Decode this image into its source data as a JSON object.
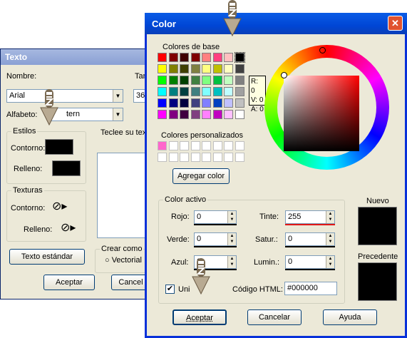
{
  "texto": {
    "title": "Texto",
    "nombre_label": "Nombre:",
    "tam_label": "Tan",
    "font_value": "Arial",
    "size_value": "36",
    "alfabeto_label": "Alfabeto:",
    "alfabeto_value": "tern",
    "estilos_label": "Estilos",
    "contorno_label": "Contorno:",
    "relleno_label": "Relleno:",
    "teclee_label": "Teclee su tex",
    "texturas_label": "Texturas",
    "tex_contorno_label": "Contorno:",
    "tex_relleno_label": "Relleno:",
    "texto_estandar": "Texto estándar",
    "crear_como": "Crear como",
    "vectorial": "Vectorial",
    "aceptar": "Aceptar",
    "cancelar": "Cancel"
  },
  "color": {
    "title": "Color",
    "colores_base": "Colores de base",
    "colores_personalizados": "Colores personalizados",
    "agregar_color": "Agregar color",
    "rva": {
      "r": "R: 0",
      "v": "V: 0",
      "a": "A: 0"
    },
    "color_activo": "Color activo",
    "rojo_label": "Rojo:",
    "rojo_value": "0",
    "verde_label": "Verde:",
    "verde_value": "0",
    "azul_label": "Azul:",
    "azul_value": "0",
    "tinte_label": "Tinte:",
    "tinte_value": "255",
    "satur_label": "Satur.:",
    "satur_value": "0",
    "lumin_label": "Lumin.:",
    "lumin_value": "0",
    "unir_label": "Uni",
    "html_label": "Código HTML:",
    "html_value": "#000000",
    "nuevo": "Nuevo",
    "precedente": "Precedente",
    "aceptar": "Aceptar",
    "cancelar": "Cancelar",
    "ayuda": "Ayuda",
    "close": "✕"
  },
  "palette": [
    [
      "#ff0000",
      "#800000",
      "#400000",
      "#800000",
      "#ff8080",
      "#ff4080",
      "#ffc0c0",
      "#000000"
    ],
    [
      "#ffff00",
      "#808000",
      "#404000",
      "#808040",
      "#ffff80",
      "#c0c000",
      "#ffffc0",
      "#404040"
    ],
    [
      "#00ff00",
      "#008000",
      "#004000",
      "#408040",
      "#80ff80",
      "#00c040",
      "#c0ffc0",
      "#808080"
    ],
    [
      "#00ffff",
      "#008080",
      "#004040",
      "#408080",
      "#80ffff",
      "#00c0c0",
      "#c0ffff",
      "#a0a0a0"
    ],
    [
      "#0000ff",
      "#000080",
      "#000040",
      "#404080",
      "#8080ff",
      "#0040c0",
      "#c0c0ff",
      "#c0c0c0"
    ],
    [
      "#ff00ff",
      "#800080",
      "#400040",
      "#804080",
      "#ff80ff",
      "#c000c0",
      "#ffc0ff",
      "#ffffff"
    ]
  ],
  "custom_colors": [
    "#ff66cc",
    "#ffffff",
    "#ffffff",
    "#ffffff",
    "#ffffff",
    "#ffffff",
    "#ffffff",
    "#ffffff",
    "#ffffff",
    "#ffffff",
    "#ffffff",
    "#ffffff",
    "#ffffff",
    "#ffffff",
    "#ffffff",
    "#ffffff"
  ],
  "accent": {
    "titlebar": "#0054e3",
    "close": "#e0532f",
    "tinte_bar": "#e01818"
  }
}
